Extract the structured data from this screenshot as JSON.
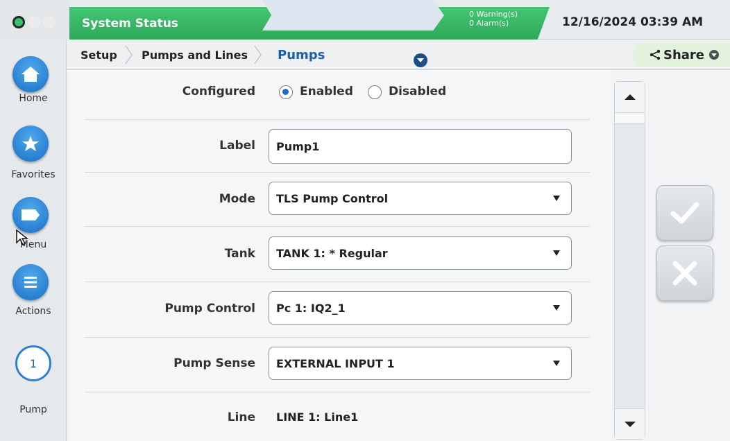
{
  "window": {
    "title": "System Status",
    "warnings": "0 Warning(s)",
    "alarms": "0 Alarm(s)",
    "datetime": "12/16/2024 03:39 AM"
  },
  "nav": {
    "home": "Home",
    "favorites": "Favorites",
    "menu": "Menu",
    "actions": "Actions",
    "pump_number": "1",
    "pump": "Pump"
  },
  "breadcrumb": {
    "setup": "Setup",
    "pumps_and_lines": "Pumps and Lines",
    "pumps": "Pumps",
    "share": "Share"
  },
  "form": {
    "configured_label": "Configured",
    "enabled_label": "Enabled",
    "disabled_label": "Disabled",
    "configured_value": "Enabled",
    "label_label": "Label",
    "label_value": "Pump1",
    "mode_label": "Mode",
    "mode_value": "TLS Pump Control",
    "tank_label": "Tank",
    "tank_value": "TANK 1: * Regular",
    "pump_control_label": "Pump Control",
    "pump_control_value": "Pc 1: IQ2_1",
    "pump_sense_label": "Pump Sense",
    "pump_sense_value": "EXTERNAL INPUT 1",
    "line_label": "Line",
    "line_value": "LINE 1: Line1"
  },
  "icons": {
    "home": "home-icon",
    "favorites": "star-icon",
    "menu": "menu-tag-icon",
    "actions": "list-icon",
    "share": "share-icon",
    "confirm": "checkmark-icon",
    "cancel": "close-icon"
  },
  "colors": {
    "status_green": "#2ea95a",
    "nav_blue": "#1a6fc4",
    "accent_blue": "#1b5fa8"
  }
}
